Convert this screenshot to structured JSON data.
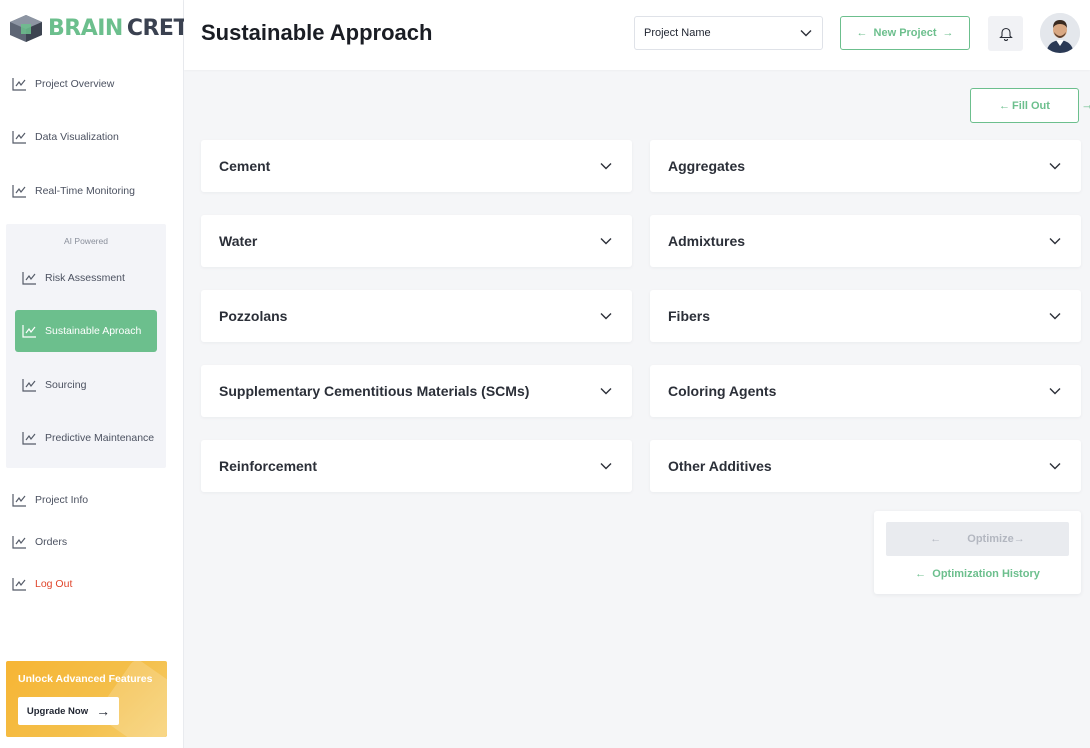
{
  "brand": {
    "part1": "BRAIN",
    "part2": "CRETE"
  },
  "header": {
    "title": "Sustainable Approach",
    "project_select": "Project Name",
    "new_project_label": "New Project"
  },
  "sidebar": {
    "top_items": [
      {
        "label": "Project Overview"
      },
      {
        "label": "Data Visualization"
      },
      {
        "label": "Real-Time Monitoring"
      }
    ],
    "ai_label": "AI Powered",
    "ai_items": [
      {
        "label": "Risk Assessment"
      },
      {
        "label": "Sustainable Aproach"
      },
      {
        "label": "Sourcing"
      },
      {
        "label": "Predictive Maintenance"
      }
    ],
    "bottom_items": [
      {
        "label": "Project Info"
      },
      {
        "label": "Orders"
      },
      {
        "label": "Log Out"
      }
    ],
    "promo": {
      "title": "Unlock Advanced Features",
      "button": "Upgrade Now"
    }
  },
  "actions": {
    "fill_out": "Fill Out"
  },
  "categories": [
    "Cement",
    "Aggregates",
    "Water",
    "Admixtures",
    "Pozzolans",
    "Fibers",
    "Supplementary Cementitious Materials (SCMs)",
    "Coloring Agents",
    "Reinforcement",
    "Other Additives"
  ],
  "optimize": {
    "button": "Optimize",
    "history": "Optimization History"
  },
  "colors": {
    "accent": "#6cbf8d",
    "danger": "#e0452b",
    "promo": "#f6b534"
  }
}
